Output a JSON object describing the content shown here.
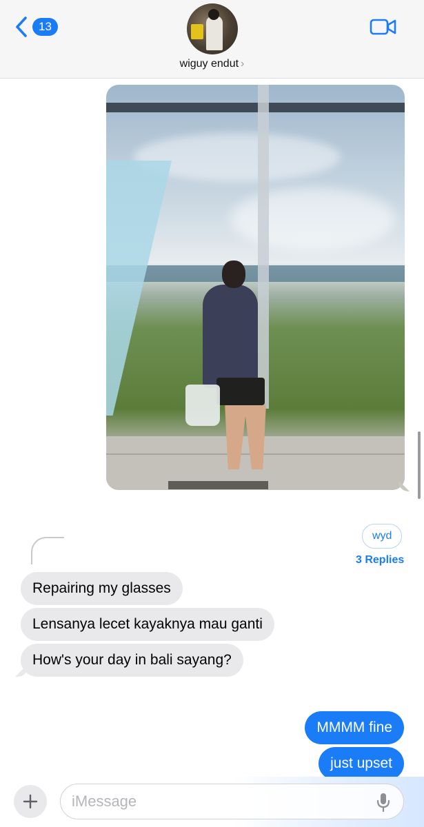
{
  "header": {
    "back_count": "13",
    "contact_name": "wiguy endut",
    "name_chevron": "›"
  },
  "thread": {
    "reply_context_text": "wyd",
    "replies_label": "3 Replies"
  },
  "messages": [
    {
      "direction": "incoming",
      "text": "Repairing my glasses"
    },
    {
      "direction": "incoming",
      "text": "Lensanya lecet kayaknya mau ganti"
    },
    {
      "direction": "incoming",
      "text": "How's your day in bali sayang?"
    },
    {
      "direction": "outgoing",
      "text": "MMMM fine"
    },
    {
      "direction": "outgoing",
      "text": "just upset"
    }
  ],
  "composer": {
    "placeholder": "iMessage",
    "value": ""
  },
  "colors": {
    "accent": "#1a7cf6",
    "incoming_bubble": "#e9e9eb",
    "header_bg": "#f6f6f7"
  },
  "icons": {
    "back": "chevron-left-icon",
    "video": "video-camera-icon",
    "plus": "plus-icon",
    "mic": "microphone-icon"
  }
}
